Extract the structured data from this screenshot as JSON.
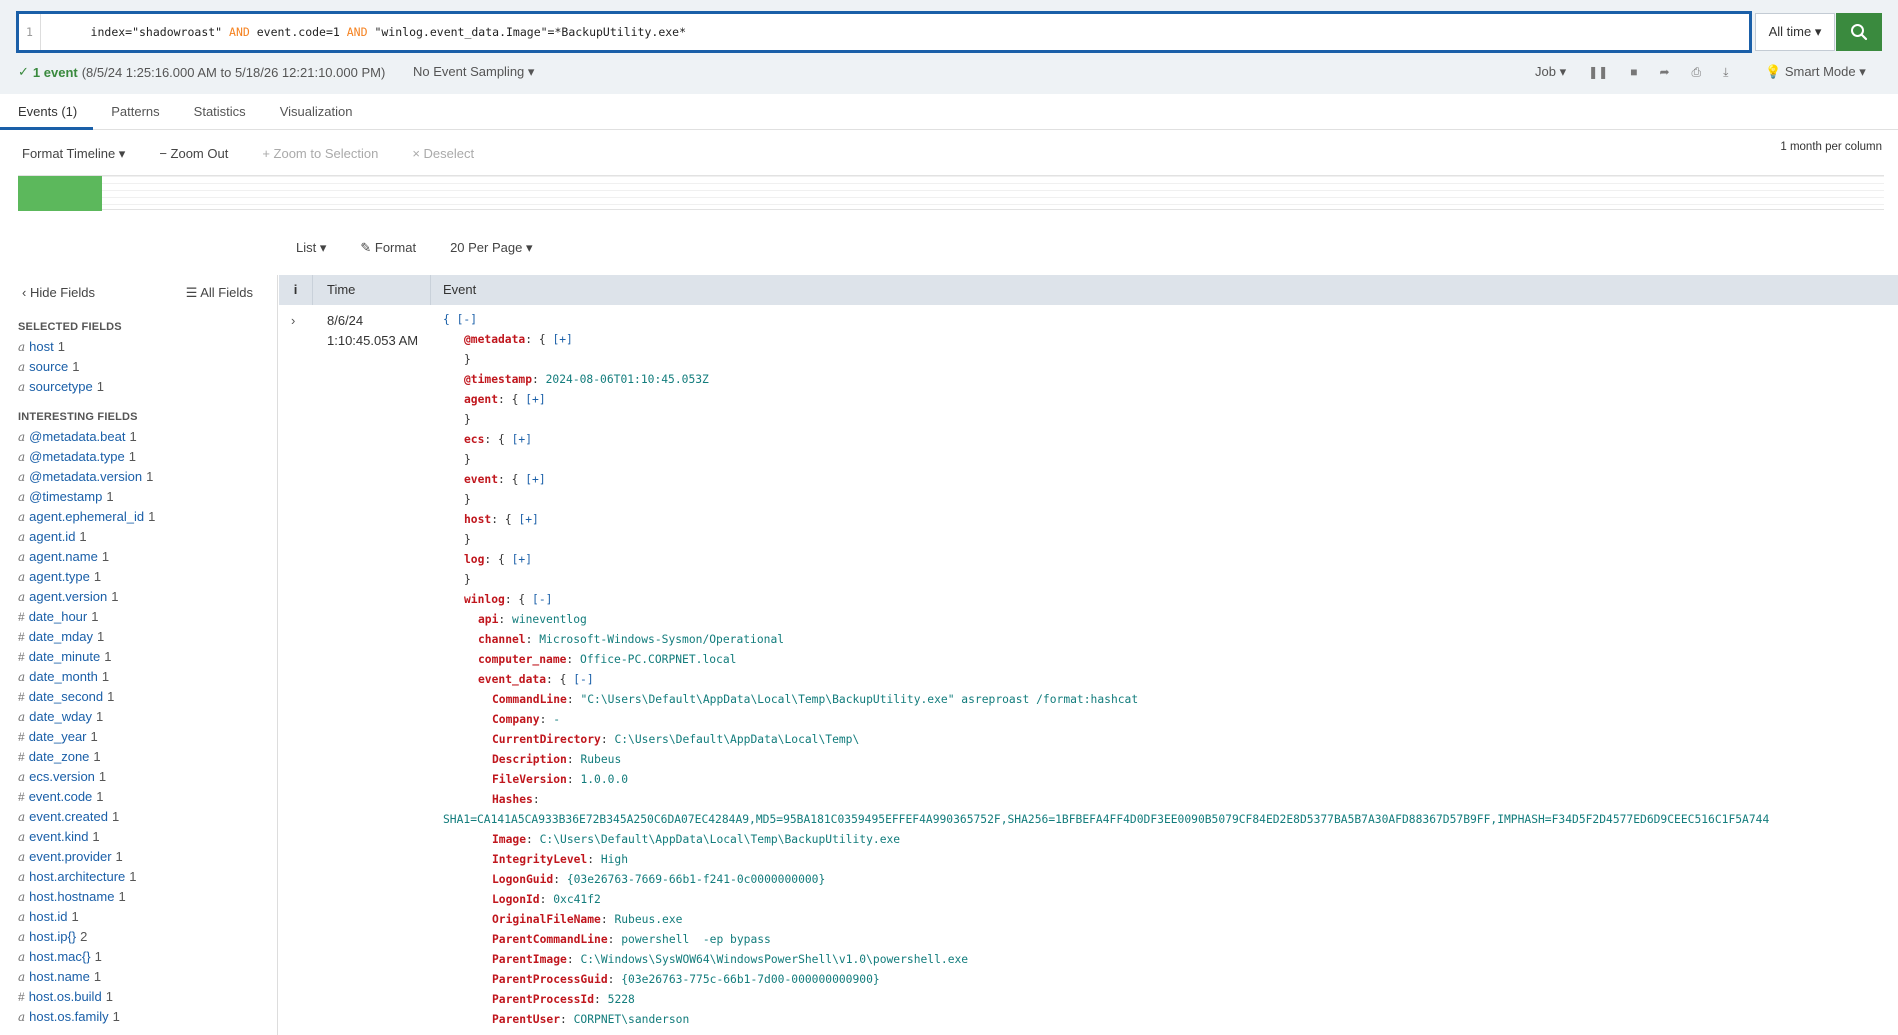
{
  "search": {
    "line_number": "1",
    "query_parts": [
      "index=\"shadowroast\" ",
      "AND",
      " event.code=1 ",
      "AND",
      " \"winlog.event_data.Image\"=*BackupUtility.exe*"
    ],
    "time_range": "All time ▾",
    "search_icon": "magnifier-icon"
  },
  "status": {
    "count": "1 event",
    "range": "(8/5/24 1:25:16.000 AM to 5/18/26 12:21:10.000 PM)",
    "sampling": "No Event Sampling ▾",
    "job": "Job ▾",
    "mode": "Smart Mode ▾"
  },
  "tabs": [
    "Events (1)",
    "Patterns",
    "Statistics",
    "Visualization"
  ],
  "timeline": {
    "format": "Format Timeline ▾",
    "zoom_out": "− Zoom Out",
    "zoom_selection": "+ Zoom to Selection",
    "deselect": "× Deselect",
    "per_column": "1 month per column",
    "bar_fraction": 0.045
  },
  "list_controls": {
    "list": "List ▾",
    "format": "✎ Format",
    "per_page": "20 Per Page ▾"
  },
  "sidebar": {
    "hide": "‹ Hide Fields",
    "all": "☰ All Fields",
    "selected_title": "SELECTED FIELDS",
    "selected": [
      {
        "t": "a",
        "name": "host",
        "count": "1"
      },
      {
        "t": "a",
        "name": "source",
        "count": "1"
      },
      {
        "t": "a",
        "name": "sourcetype",
        "count": "1"
      }
    ],
    "interesting_title": "INTERESTING FIELDS",
    "interesting": [
      {
        "t": "a",
        "name": "@metadata.beat",
        "count": "1"
      },
      {
        "t": "a",
        "name": "@metadata.type",
        "count": "1"
      },
      {
        "t": "a",
        "name": "@metadata.version",
        "count": "1"
      },
      {
        "t": "a",
        "name": "@timestamp",
        "count": "1"
      },
      {
        "t": "a",
        "name": "agent.ephemeral_id",
        "count": "1"
      },
      {
        "t": "a",
        "name": "agent.id",
        "count": "1"
      },
      {
        "t": "a",
        "name": "agent.name",
        "count": "1"
      },
      {
        "t": "a",
        "name": "agent.type",
        "count": "1"
      },
      {
        "t": "a",
        "name": "agent.version",
        "count": "1"
      },
      {
        "t": "#",
        "name": "date_hour",
        "count": "1"
      },
      {
        "t": "#",
        "name": "date_mday",
        "count": "1"
      },
      {
        "t": "#",
        "name": "date_minute",
        "count": "1"
      },
      {
        "t": "a",
        "name": "date_month",
        "count": "1"
      },
      {
        "t": "#",
        "name": "date_second",
        "count": "1"
      },
      {
        "t": "a",
        "name": "date_wday",
        "count": "1"
      },
      {
        "t": "#",
        "name": "date_year",
        "count": "1"
      },
      {
        "t": "#",
        "name": "date_zone",
        "count": "1"
      },
      {
        "t": "a",
        "name": "ecs.version",
        "count": "1"
      },
      {
        "t": "#",
        "name": "event.code",
        "count": "1"
      },
      {
        "t": "a",
        "name": "event.created",
        "count": "1"
      },
      {
        "t": "a",
        "name": "event.kind",
        "count": "1"
      },
      {
        "t": "a",
        "name": "event.provider",
        "count": "1"
      },
      {
        "t": "a",
        "name": "host.architecture",
        "count": "1"
      },
      {
        "t": "a",
        "name": "host.hostname",
        "count": "1"
      },
      {
        "t": "a",
        "name": "host.id",
        "count": "1"
      },
      {
        "t": "a",
        "name": "host.ip{}",
        "count": "2"
      },
      {
        "t": "a",
        "name": "host.mac{}",
        "count": "1"
      },
      {
        "t": "a",
        "name": "host.name",
        "count": "1"
      },
      {
        "t": "#",
        "name": "host.os.build",
        "count": "1"
      },
      {
        "t": "a",
        "name": "host.os.family",
        "count": "1"
      }
    ]
  },
  "table": {
    "col_i": "i",
    "col_time": "Time",
    "col_event": "Event"
  },
  "event": {
    "date": "8/6/24",
    "time": "1:10:45.053 AM",
    "lines": [
      {
        "lvl": 0,
        "k": "",
        "sep": "",
        "v": "",
        "b": "{ [-]"
      },
      {
        "lvl": 1,
        "k": "@metadata",
        "sep": ": { ",
        "v": "",
        "b": "[+]"
      },
      {
        "lvl": 1,
        "k": "",
        "sep": "}",
        "v": "",
        "b": ""
      },
      {
        "lvl": 1,
        "k": "@timestamp",
        "sep": ": ",
        "v": "2024-08-06T01:10:45.053Z",
        "b": ""
      },
      {
        "lvl": 1,
        "k": "agent",
        "sep": ": { ",
        "v": "",
        "b": "[+]"
      },
      {
        "lvl": 1,
        "k": "",
        "sep": "}",
        "v": "",
        "b": ""
      },
      {
        "lvl": 1,
        "k": "ecs",
        "sep": ": { ",
        "v": "",
        "b": "[+]"
      },
      {
        "lvl": 1,
        "k": "",
        "sep": "}",
        "v": "",
        "b": ""
      },
      {
        "lvl": 1,
        "k": "event",
        "sep": ": { ",
        "v": "",
        "b": "[+]"
      },
      {
        "lvl": 1,
        "k": "",
        "sep": "}",
        "v": "",
        "b": ""
      },
      {
        "lvl": 1,
        "k": "host",
        "sep": ": { ",
        "v": "",
        "b": "[+]"
      },
      {
        "lvl": 1,
        "k": "",
        "sep": "}",
        "v": "",
        "b": ""
      },
      {
        "lvl": 1,
        "k": "log",
        "sep": ": { ",
        "v": "",
        "b": "[+]"
      },
      {
        "lvl": 1,
        "k": "",
        "sep": "}",
        "v": "",
        "b": ""
      },
      {
        "lvl": 1,
        "k": "winlog",
        "sep": ": { ",
        "v": "",
        "b": "[-]"
      },
      {
        "lvl": 2,
        "k": "api",
        "sep": ": ",
        "v": "wineventlog",
        "b": ""
      },
      {
        "lvl": 2,
        "k": "channel",
        "sep": ": ",
        "v": "Microsoft-Windows-Sysmon/Operational",
        "b": ""
      },
      {
        "lvl": 2,
        "k": "computer_name",
        "sep": ": ",
        "v": "Office-PC.CORPNET.local",
        "b": ""
      },
      {
        "lvl": 2,
        "k": "event_data",
        "sep": ": { ",
        "v": "",
        "b": "[-]"
      },
      {
        "lvl": 3,
        "k": "CommandLine",
        "sep": ": ",
        "v": "\"C:\\Users\\Default\\AppData\\Local\\Temp\\BackupUtility.exe\" asreproast /format:hashcat",
        "b": ""
      },
      {
        "lvl": 3,
        "k": "Company",
        "sep": ": ",
        "v": "-",
        "b": ""
      },
      {
        "lvl": 3,
        "k": "CurrentDirectory",
        "sep": ": ",
        "v": "C:\\Users\\Default\\AppData\\Local\\Temp\\",
        "b": ""
      },
      {
        "lvl": 3,
        "k": "Description",
        "sep": ": ",
        "v": "Rubeus",
        "b": ""
      },
      {
        "lvl": 3,
        "k": "FileVersion",
        "sep": ": ",
        "v": "1.0.0.0",
        "b": ""
      },
      {
        "lvl": 3,
        "k": "Hashes",
        "sep": ": ",
        "v": "",
        "b": ""
      },
      {
        "lvl": 0,
        "k": "",
        "sep": "",
        "v": "SHA1=CA141A5CA933B36E72B345A250C6DA07EC4284A9,MD5=95BA181C0359495EFFEF4A990365752F,SHA256=1BFBEFA4FF4D0DF3EE0090B5079CF84ED2E8D5377BA5B7A30AFD88367D57B9FF,IMPHASH=F34D5F2D4577ED6D9CEEC516C1F5A744",
        "b": ""
      },
      {
        "lvl": 3,
        "k": "Image",
        "sep": ": ",
        "v": "C:\\Users\\Default\\AppData\\Local\\Temp\\BackupUtility.exe",
        "b": ""
      },
      {
        "lvl": 3,
        "k": "IntegrityLevel",
        "sep": ": ",
        "v": "High",
        "b": ""
      },
      {
        "lvl": 3,
        "k": "LogonGuid",
        "sep": ": ",
        "v": "{03e26763-7669-66b1-f241-0c0000000000}",
        "b": ""
      },
      {
        "lvl": 3,
        "k": "LogonId",
        "sep": ": ",
        "v": "0xc41f2",
        "b": ""
      },
      {
        "lvl": 3,
        "k": "OriginalFileName",
        "sep": ": ",
        "v": "Rubeus.exe",
        "b": ""
      },
      {
        "lvl": 3,
        "k": "ParentCommandLine",
        "sep": ": ",
        "v": "powershell  -ep bypass",
        "b": ""
      },
      {
        "lvl": 3,
        "k": "ParentImage",
        "sep": ": ",
        "v": "C:\\Windows\\SysWOW64\\WindowsPowerShell\\v1.0\\powershell.exe",
        "b": ""
      },
      {
        "lvl": 3,
        "k": "ParentProcessGuid",
        "sep": ": ",
        "v": "{03e26763-775c-66b1-7d00-000000000900}",
        "b": ""
      },
      {
        "lvl": 3,
        "k": "ParentProcessId",
        "sep": ": ",
        "v": "5228",
        "b": ""
      },
      {
        "lvl": 3,
        "k": "ParentUser",
        "sep": ": ",
        "v": "CORPNET\\sanderson",
        "b": ""
      }
    ]
  }
}
